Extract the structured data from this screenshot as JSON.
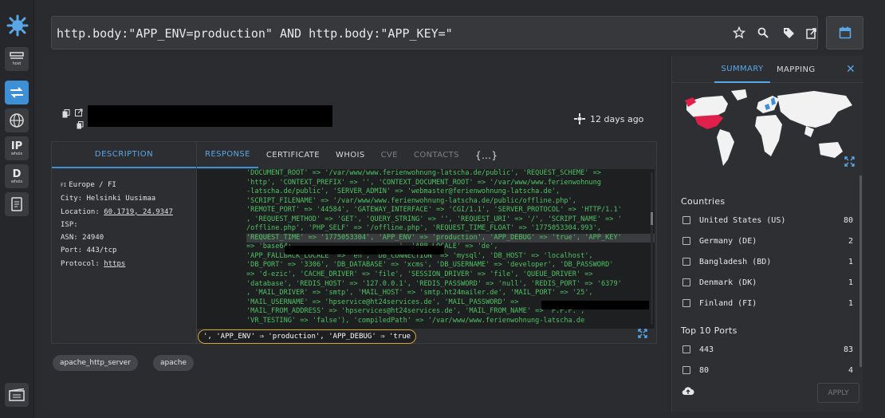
{
  "search": {
    "query": "http.body:\"APP_ENV=production\" AND http.body:\"APP_KEY=\""
  },
  "sidebar": {
    "items": [
      {
        "label": "host",
        "icon": "host-icon"
      },
      {
        "label": "",
        "icon": "swap-icon"
      },
      {
        "label": "DNS",
        "icon": "globe-icon"
      },
      {
        "label": "IP",
        "sub": "whois",
        "icon": "ip-whois-icon"
      },
      {
        "label": "D",
        "sub": "whois",
        "icon": "domain-whois-icon"
      },
      {
        "label": "",
        "icon": "report-icon"
      },
      {
        "label": "",
        "icon": "film-icon"
      }
    ]
  },
  "result": {
    "time_ago": "12 days ago"
  },
  "panel": {
    "desc_tab": "DESCRIPTION",
    "tabs": [
      "RESPONSE",
      "CERTIFICATE",
      "WHOIS",
      "CVE",
      "CONTACTS",
      "{…}"
    ],
    "desc": {
      "region": "Europe / FI",
      "city": "City: Helsinki Uusimaa",
      "location_label": "Location: ",
      "location_value": "60.1719, 24.9347",
      "isp": "ISP:",
      "asn": "ASN: 24940",
      "port": "Port: 443/tcp",
      "protocol_label": "Protocol: ",
      "protocol_value": "https"
    },
    "code_lines": [
      "'DOCUMENT_ROOT' => '/var/www/www.ferienwohnung-latscha.de/public', 'REQUEST_SCHEME' =>",
      "'http', 'CONTEXT_PREFIX' => '', 'CONTEXT_DOCUMENT_ROOT' => '/var/www/www.ferienwohnung",
      "-latscha.de/public', 'SERVER_ADMIN' => 'webmaster@ferienwohnung-latscha.de',",
      "'SCRIPT_FILENAME' => '/var/www/www.ferienwohnung-latscha.de/public/offline.php',",
      "'REMOTE_PORT' => '44584', 'GATEWAY_INTERFACE' => 'CGI/1.1', 'SERVER_PROTOCOL' => 'HTTP/1.1'",
      ", 'REQUEST_METHOD' => 'GET', 'QUERY_STRING' => '', 'REQUEST_URI' => '/', 'SCRIPT_NAME' => '",
      "/offline.php', 'PHP_SELF' => '/offline.php', 'REQUEST_TIME_FLOAT' => '1775053304.993',",
      "'REQUEST_TIME' => '1775053304', 'APP_ENV' => 'production', 'APP_DEBUG' => 'true', 'APP_KEY'",
      "=> 'base64:                          ', 'APP_LOCALE' => 'de',",
      "'APP_FALLBACK_LOCALE' => 'en', 'DB_CONNECTION' => 'mysql', 'DB_HOST' => 'localhost',",
      "'DB_PORT' => '3306', 'DB_DATABASE' => 'xcms', 'DB_USERNAME' => 'developer', 'DB_PASSWORD'",
      "=> 'd-ezic', 'CACHE_DRIVER' => 'file', 'SESSION_DRIVER' => 'file', 'QUEUE_DRIVER' =>",
      "'database', 'REDIS_HOST' => '127.0.0.1', 'REDIS_PASSWORD' => 'null', 'REDIS_PORT' => '6379'",
      ", 'MAIL_DRIVER' => 'smtp', 'MAIL_HOST' => 'smtp.ht24mailer.de', 'MAIL_PORT' => '25',",
      "'MAIL_USERNAME' => 'hpservice@ht24services.de', 'MAIL_PASSWORD' =>",
      "'MAIL_FROM_ADDRESS' => 'hpservices@ht24services.de', 'MAIL_FROM_NAME' => 'P.F.F.',",
      "'VR_TESTING' => 'false'), 'compiledPath' => '/var/www/www.ferienwohnung-latscha.de"
    ],
    "snippet": "', 'APP_ENV' ⇒ 'production', 'APP_DEBUG' ⇒ 'true"
  },
  "chips": [
    "apache_http_server",
    "apache"
  ],
  "right": {
    "tabs": [
      "SUMMARY",
      "MAPPING"
    ],
    "countries_title": "Countries",
    "countries": [
      {
        "name": "United States (US)",
        "count": "80"
      },
      {
        "name": "Germany (DE)",
        "count": "2"
      },
      {
        "name": "Bangladesh (BD)",
        "count": "1"
      },
      {
        "name": "Denmark (DK)",
        "count": "1"
      },
      {
        "name": "Finland (FI)",
        "count": "1"
      }
    ],
    "ports_title": "Top 10 Ports",
    "ports": [
      {
        "name": "443",
        "count": "83"
      },
      {
        "name": "80",
        "count": "4"
      }
    ],
    "apply_label": "APPLY",
    "colors": {
      "accent": "#5aa7e8",
      "highlight": "#e0204a"
    }
  }
}
